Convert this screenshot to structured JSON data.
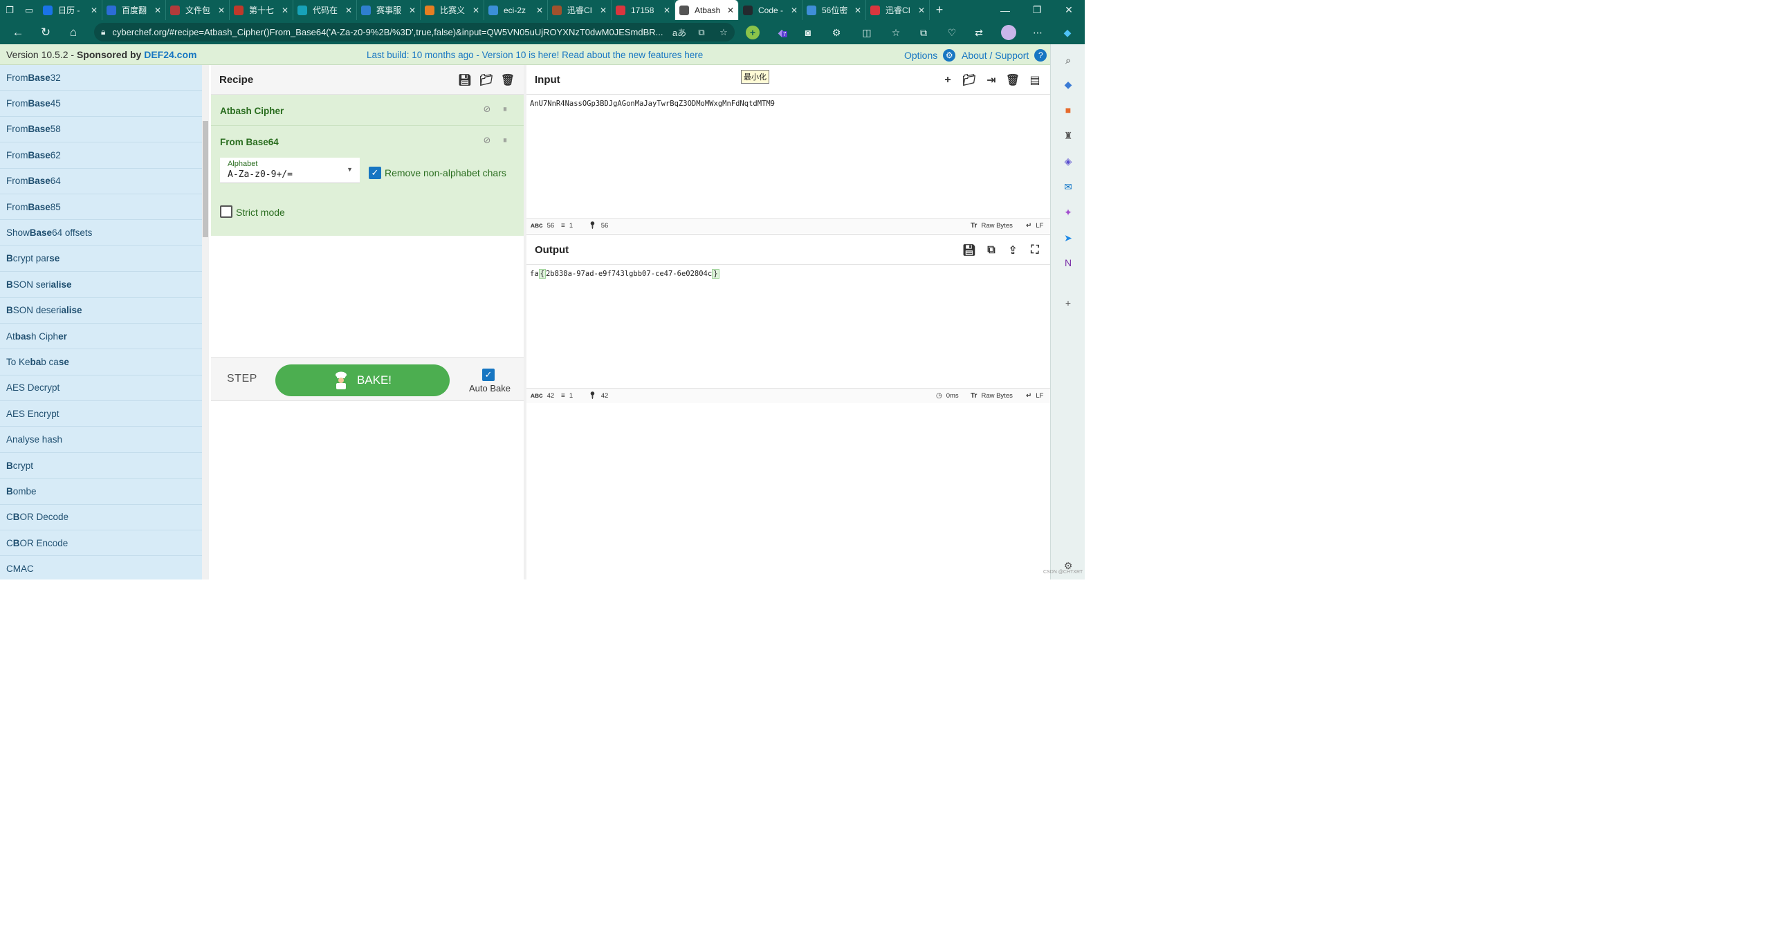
{
  "browser": {
    "tabs": [
      {
        "label": "日历 -",
        "color": "#1a73e8"
      },
      {
        "label": "百度翻",
        "color": "#2c6cd6"
      },
      {
        "label": "文件包",
        "color": "#b23b3b"
      },
      {
        "label": "第十七",
        "color": "#c0392b"
      },
      {
        "label": "代码在",
        "color": "#17a2b8"
      },
      {
        "label": "赛事服",
        "color": "#2f7fd0"
      },
      {
        "label": "比赛义",
        "color": "#e67e22"
      },
      {
        "label": "eci-2z",
        "color": "#3b8fd8"
      },
      {
        "label": "迅睿CI",
        "color": "#a0522d"
      },
      {
        "label": "17158",
        "color": "#d9363e"
      },
      {
        "label": "Atbash",
        "color": "#555555"
      },
      {
        "label": "Code -",
        "color": "#24292e"
      },
      {
        "label": "56位密",
        "color": "#3f8ed8"
      },
      {
        "label": "迅睿CI",
        "color": "#d9363e"
      }
    ],
    "active_tab_index": 10,
    "url": "cyberchef.org/#recipe=Atbash_Cipher()From_Base64('A-Za-z0-9%2B/%3D',true,false)&input=QW5VN05uUjROYXNzT0dwM0JESmdBR...",
    "translate_glyph": "aあ",
    "extension_badge": "7",
    "accent": "#0b5f57"
  },
  "banner": {
    "version": "Version 10.5.2",
    "sponsored": "Sponsored",
    "by": "by",
    "sponsor": "DEF24.com",
    "build_text": "Last build: 10 months ago - Version 10 is here! Read about the new features here",
    "options": "Options",
    "about": "About / Support"
  },
  "operations": [
    [
      "From ",
      "Base",
      "32",
      ""
    ],
    [
      "From ",
      "Base",
      "45",
      ""
    ],
    [
      "From ",
      "Base",
      "58",
      ""
    ],
    [
      "From ",
      "Base",
      "62",
      ""
    ],
    [
      "From ",
      "Base",
      "64",
      ""
    ],
    [
      "From ",
      "Base",
      "85",
      ""
    ],
    [
      "Show ",
      "Base",
      "64 offsets",
      ""
    ],
    [
      "",
      "B",
      "crypt par",
      "se"
    ],
    [
      "",
      "B",
      "SON seri",
      "alise"
    ],
    [
      "",
      "B",
      "SON deseri",
      "alise"
    ],
    [
      "At",
      "bas",
      "h Ciph",
      "er"
    ],
    [
      "To Ke",
      "ba",
      "b ca",
      "se"
    ],
    [
      "AES Decrypt",
      "",
      "",
      ""
    ],
    [
      "AES Encrypt",
      "",
      "",
      ""
    ],
    [
      "Analyse hash",
      "",
      "",
      ""
    ],
    [
      "",
      "B",
      "crypt",
      ""
    ],
    [
      "",
      "B",
      "ombe",
      ""
    ],
    [
      "C",
      "B",
      "OR Decode",
      ""
    ],
    [
      "C",
      "B",
      "OR Encode",
      ""
    ],
    [
      "CMAC",
      "",
      "",
      ""
    ]
  ],
  "recipe": {
    "title": "Recipe",
    "op1": {
      "name": "Atbash Cipher"
    },
    "op2": {
      "name": "From Base64",
      "alphabet_label": "Alphabet",
      "alphabet_value": "A-Za-z0-9+/=",
      "remove_label": "Remove non-alphabet chars",
      "remove_checked": true,
      "strict_label": "Strict mode",
      "strict_checked": false
    },
    "step": "STEP",
    "bake": "BAKE!",
    "autobake": "Auto Bake",
    "autobake_checked": true
  },
  "input": {
    "title": "Input",
    "text": "AnU7NnR4NassOGp3BDJgAGonMaJayTwrBqZ3ODMoMWxgMnFdNqtdMTM9",
    "chars": "56",
    "lines": "1",
    "pos": "56",
    "encoding": "Raw Bytes",
    "eol": "LF",
    "tooltip": "最小化"
  },
  "output": {
    "title": "Output",
    "prefix": "fa",
    "open": "{",
    "body": "2b838a-97ad-e9f743lgbb07-ce47-6e02804c",
    "close": "}",
    "chars": "42",
    "lines": "1",
    "pos": "42",
    "time": "0ms",
    "encoding": "Raw Bytes",
    "eol": "LF"
  },
  "watermark": "CSDN @CHTXRT"
}
